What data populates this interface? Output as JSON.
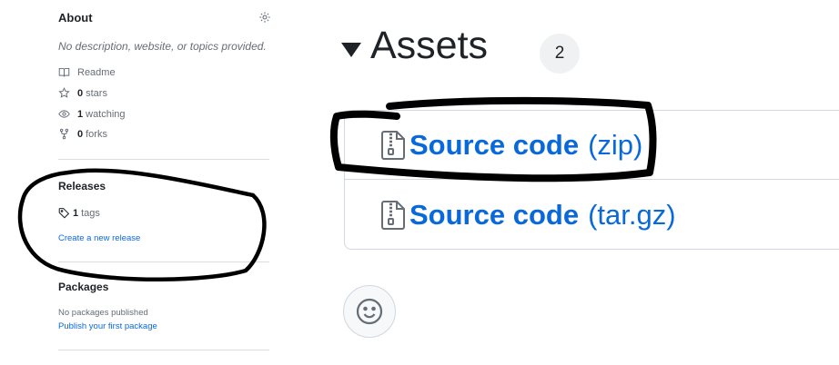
{
  "sidebar": {
    "about_title": "About",
    "description": "No description, website, or topics provided.",
    "readme_label": "Readme",
    "stars_count": "0",
    "stars_label": "stars",
    "watching_count": "1",
    "watching_label": "watching",
    "forks_count": "0",
    "forks_label": "forks",
    "releases_title": "Releases",
    "tags_count": "1",
    "tags_label": "tags",
    "create_release_link": "Create a new release",
    "packages_title": "Packages",
    "no_packages_text": "No packages published",
    "publish_package_link": "Publish your first package"
  },
  "assets": {
    "title": "Assets",
    "count": "2",
    "items": [
      {
        "name": "Source code",
        "ext": "(zip)"
      },
      {
        "name": "Source code",
        "ext": "(tar.gz)"
      }
    ]
  },
  "colors": {
    "link": "#0969da",
    "annotation": "#000000"
  }
}
